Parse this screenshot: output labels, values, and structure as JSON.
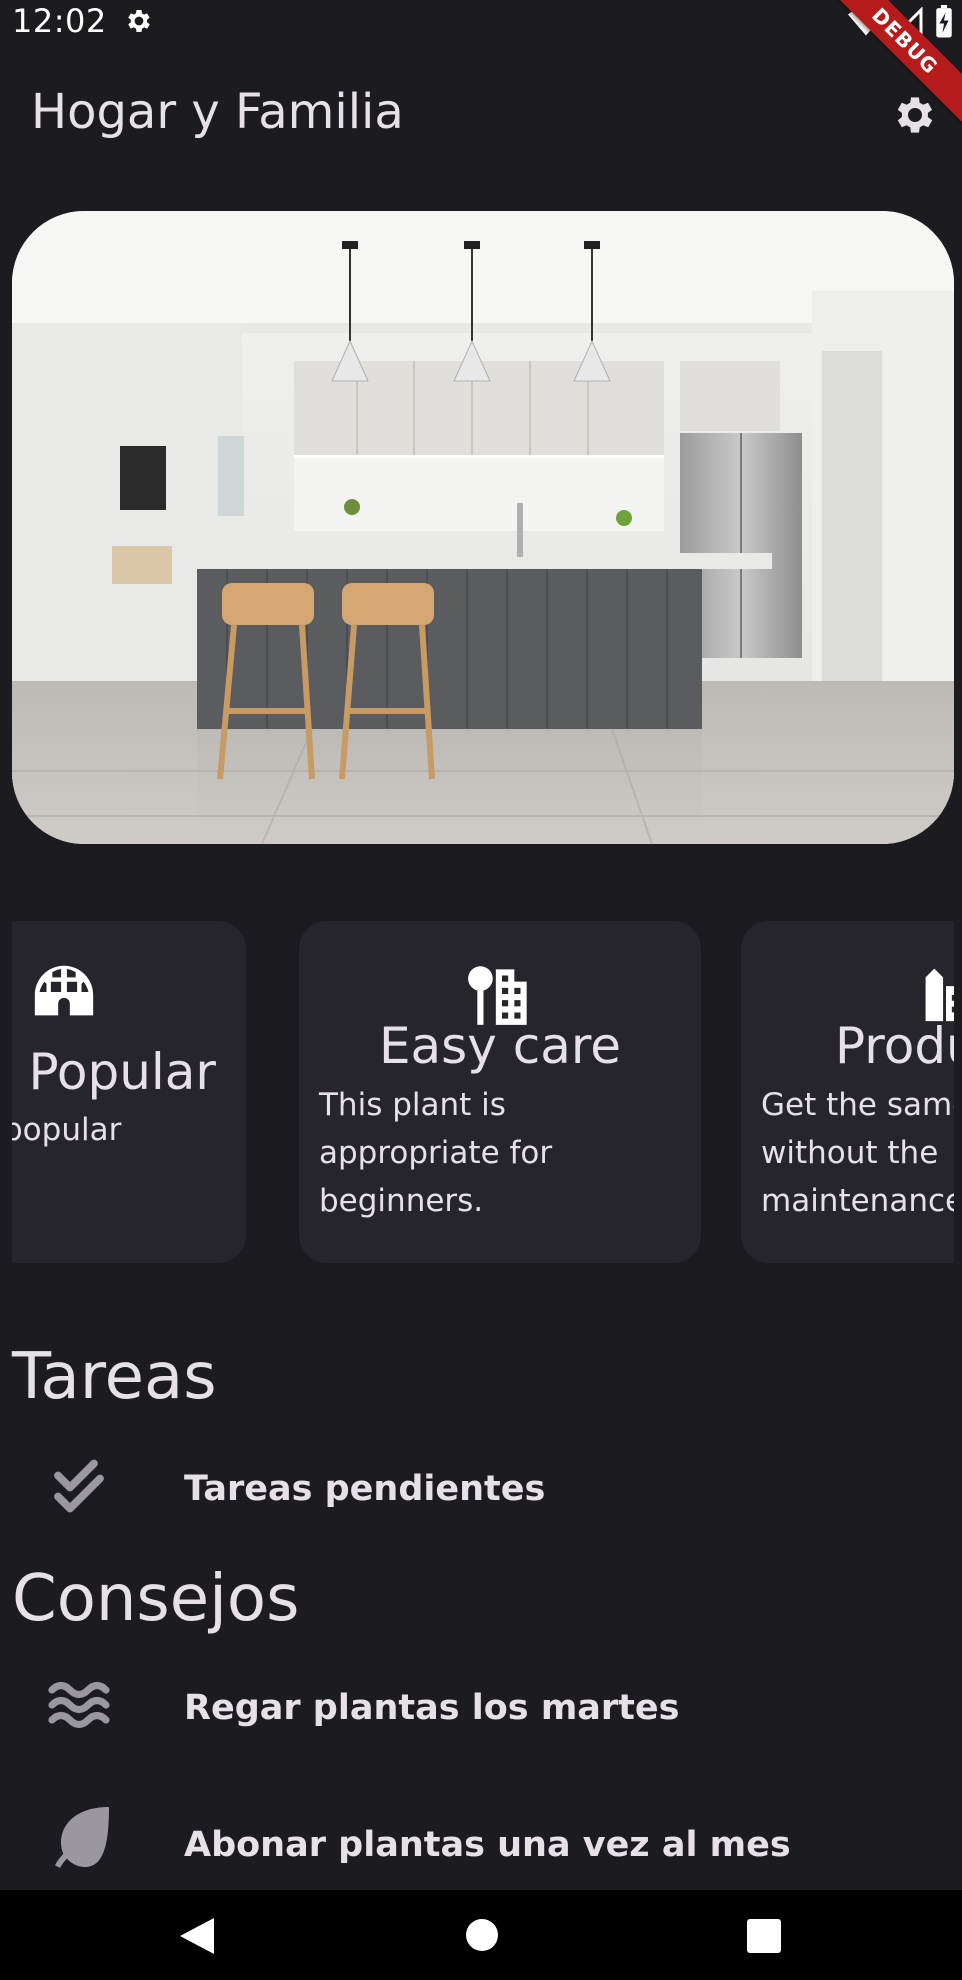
{
  "status_bar": {
    "time": "12:02",
    "debug_label": "DEBUG"
  },
  "app_bar": {
    "title": "Hogar y Familia"
  },
  "cards": [
    {
      "icon": "igloo-icon",
      "title": "t Popular",
      "description": "popular"
    },
    {
      "icon": "city-tree-icon",
      "title": "Easy care",
      "description": "This plant is appropriate for beginners."
    },
    {
      "icon": "building-icon",
      "title": "Produ",
      "description": "Get the same without the maintenance"
    }
  ],
  "tasks": {
    "title": "Tareas",
    "items": [
      {
        "icon": "double-check-icon",
        "label": "Tareas pendientes"
      }
    ]
  },
  "tips": {
    "title": "Consejos",
    "items": [
      {
        "icon": "water-waves-icon",
        "label": "Regar plantas los martes"
      },
      {
        "icon": "leaf-icon",
        "label": "Abonar plantas una vez al mes"
      }
    ]
  },
  "colors": {
    "background": "#1c1b20",
    "card": "#26252b",
    "text": "#e6e1e6",
    "icon_muted": "#9a979e",
    "debug_banner": "#b71c1c"
  }
}
